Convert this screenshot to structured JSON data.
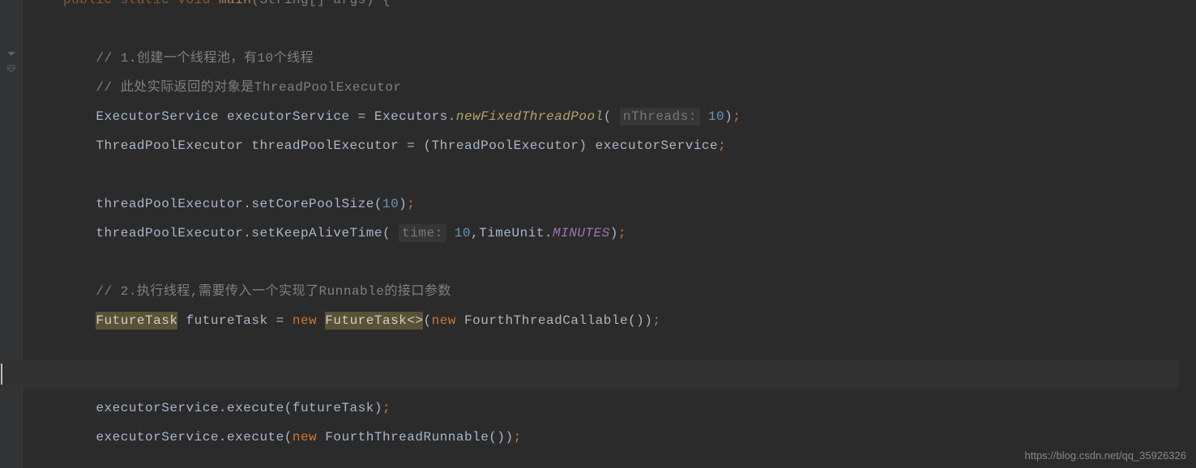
{
  "lines": {
    "l0": "public static void main(String[] args) {",
    "l2_cm": "// 1.创建一个线程池，有10个线程",
    "l3_cm": "// 此处实际返回的对象是ThreadPoolExecutor",
    "l4_a": "ExecutorService executorService = Executors.",
    "l4_fn": "newFixedThreadPool",
    "l4_hint": "nThreads:",
    "l4_num": "10",
    "l5": "ThreadPoolExecutor threadPoolExecutor = (ThreadPoolExecutor) executorService",
    "l7_a": "threadPoolExecutor.setCorePoolSize(",
    "l7_num": "10",
    "l8_a": "threadPoolExecutor.setKeepAliveTime(",
    "l8_hint": "time:",
    "l8_num": "10",
    "l8_b": ",TimeUnit.",
    "l8_c": "MINUTES",
    "l10_cm": "// 2.执行线程,需要传入一个实现了Runnable的接口参数",
    "l11_hl1": "FutureTask",
    "l11_a": " futureTask = ",
    "l11_kw": "new",
    "l11_hl2": "FutureTask<>",
    "l11_kw2": "new",
    "l11_b": " FourthThreadCallable())",
    "l14_a": "executorService.execute(futureTask)",
    "l15_a": "executorService.execute(",
    "l15_kw": "new",
    "l15_b": " FourthThreadRunnable())"
  },
  "watermark": "https://blog.csdn.net/qq_35926326"
}
